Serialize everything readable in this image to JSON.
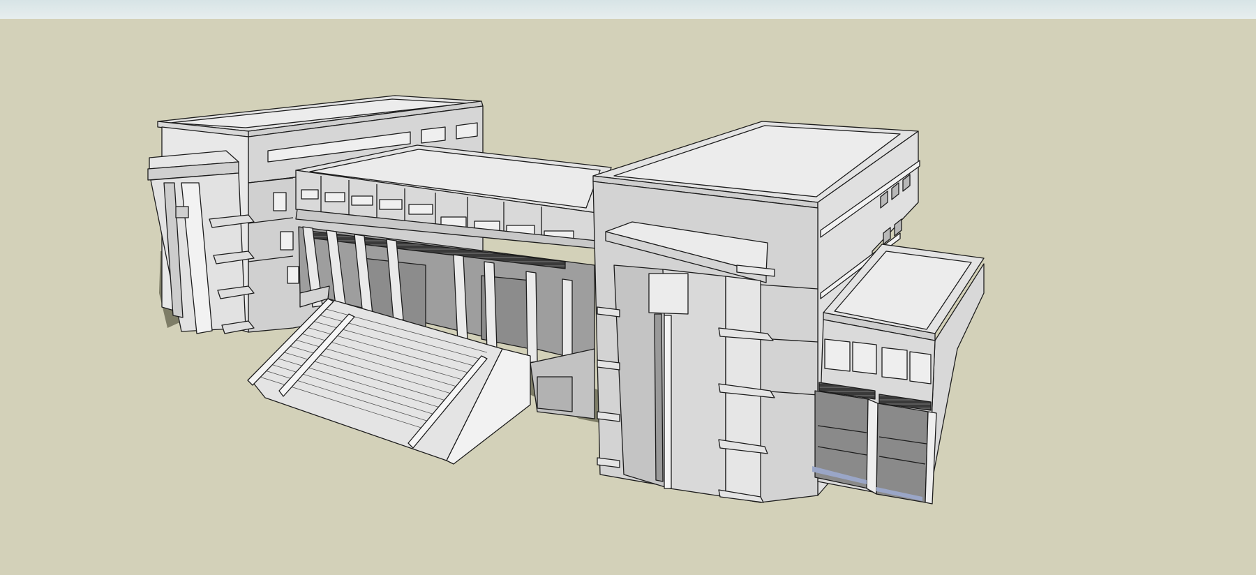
{
  "viewport": {
    "sky_color": "#dfe9ea",
    "ground_color": "#d3d1b9",
    "style": "hidden-line shaded with shadows"
  },
  "model": {
    "roof_color": "#e3e3e3",
    "face_light": "#e9e9e9",
    "face_mid": "#d6d6d6",
    "face_dark": "#b2b2b2",
    "glass_dark": "#8a8a8a",
    "edge_color": "#1c1c1c",
    "shadow_color": "#6f6f58"
  }
}
